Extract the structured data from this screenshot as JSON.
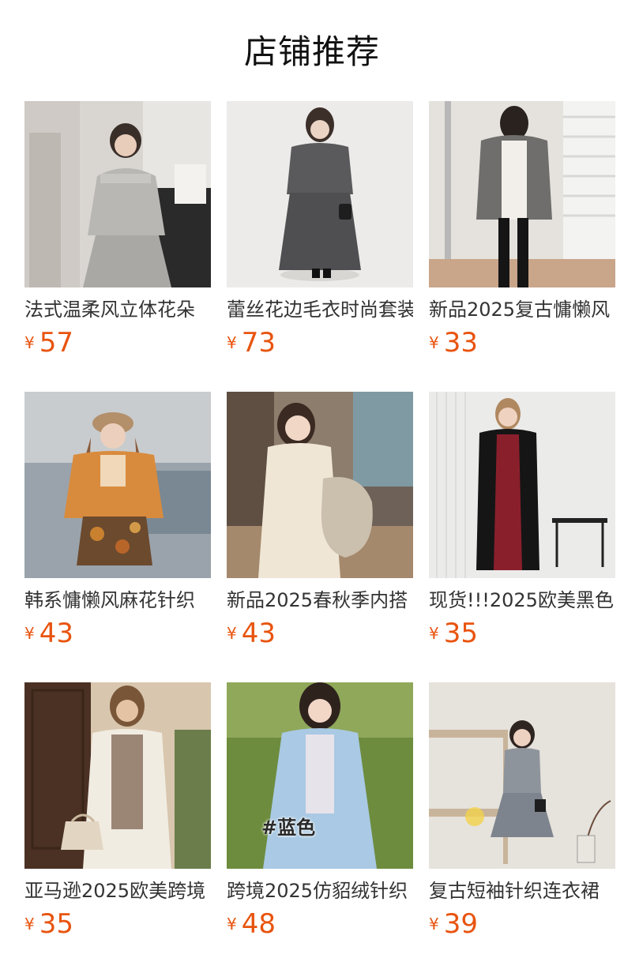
{
  "page": {
    "title": "店铺推荐"
  },
  "currency_symbol": "¥",
  "products": [
    {
      "title": "法式温柔风立体花朵",
      "price": "57",
      "image": "product-photo-grey-knit-set"
    },
    {
      "title": "蕾丝花边毛衣时尚套装",
      "price": "73",
      "image": "product-photo-charcoal-sweater-skirt"
    },
    {
      "title": "新品2025复古慵懒风",
      "price": "33",
      "image": "product-photo-grey-cardigan"
    },
    {
      "title": "韩系慵懒风麻花针织",
      "price": "43",
      "image": "product-photo-orange-cardigan"
    },
    {
      "title": "新品2025春秋季内搭",
      "price": "43",
      "image": "product-photo-cream-knit-dress"
    },
    {
      "title": "现货!!!2025欧美黑色",
      "price": "35",
      "image": "product-photo-black-long-cardigan"
    },
    {
      "title": "亚马逊2025欧美跨境",
      "price": "35",
      "image": "product-photo-white-fluffy-cardigan"
    },
    {
      "title": "跨境2025仿貂绒针织",
      "price": "48",
      "image": "product-photo-blue-mohair-cardigan",
      "overlay_text": "#蓝色"
    },
    {
      "title": "复古短袖针织连衣裙",
      "price": "39",
      "image": "product-photo-grey-knit-dress"
    }
  ]
}
